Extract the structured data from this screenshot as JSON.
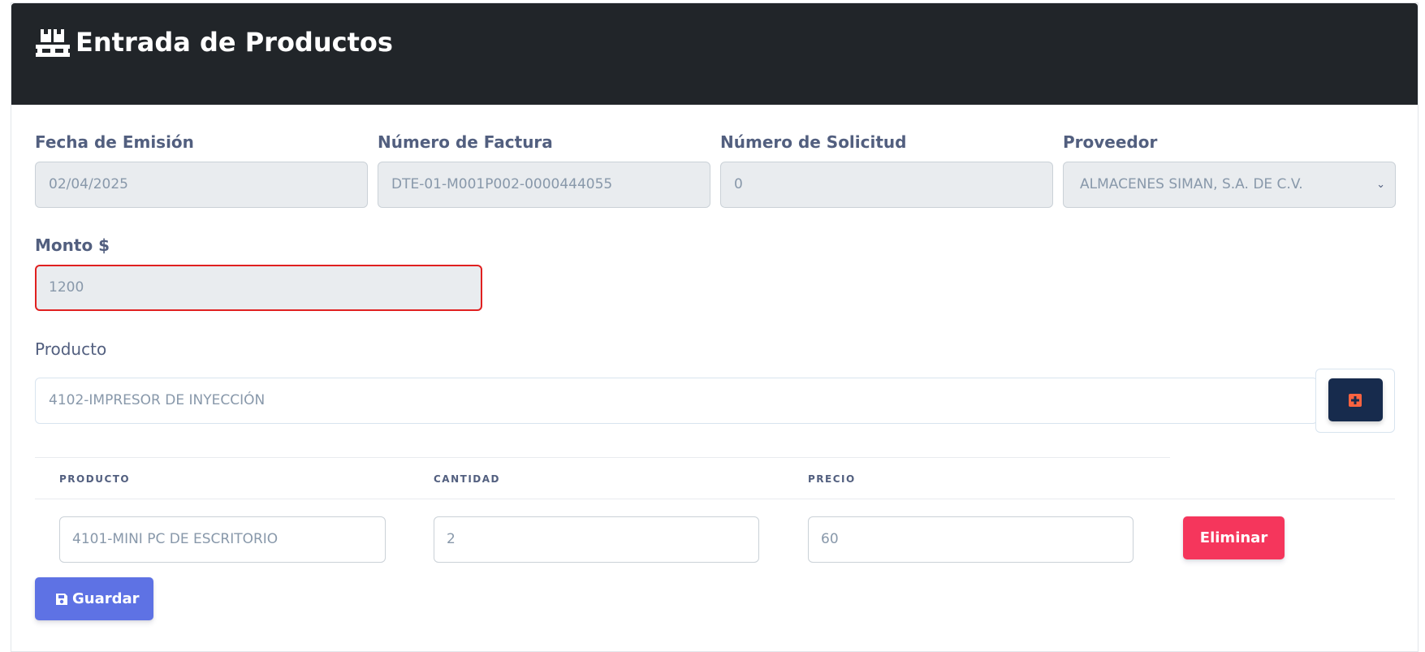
{
  "header": {
    "icon": "pallet-boxes-icon",
    "title": "Entrada de Productos"
  },
  "form": {
    "fecha_label": "Fecha de Emisión",
    "fecha_value": "02/04/2025",
    "factura_label": "Número de Factura",
    "factura_value": "DTE-01-M001P002-0000444055",
    "solicitud_label": "Número de Solicitud",
    "solicitud_value": "0",
    "proveedor_label": "Proveedor",
    "proveedor_value": "ALMACENES SIMAN, S.A. DE C.V.",
    "monto_label": "Monto $",
    "monto_value": "1200",
    "producto_label": "Producto",
    "producto_value": "4102-IMPRESOR DE INYECCIÓN",
    "add_icon": "plus-square-icon"
  },
  "table": {
    "headers": [
      "PRODUCTO",
      "CANTIDAD",
      "PRECIO"
    ],
    "rows": [
      {
        "producto": "4101-MINI PC DE ESCRITORIO",
        "cantidad": "2",
        "precio": "60",
        "delete_label": "Eliminar"
      }
    ]
  },
  "actions": {
    "save_icon": "floppy-disk-icon",
    "save_label": "Guardar"
  },
  "colors": {
    "header_bg": "#212529",
    "primary": "#5e72e4",
    "danger": "#f5365c",
    "dark_button": "#172b4d",
    "invalid_border": "#e02020"
  }
}
